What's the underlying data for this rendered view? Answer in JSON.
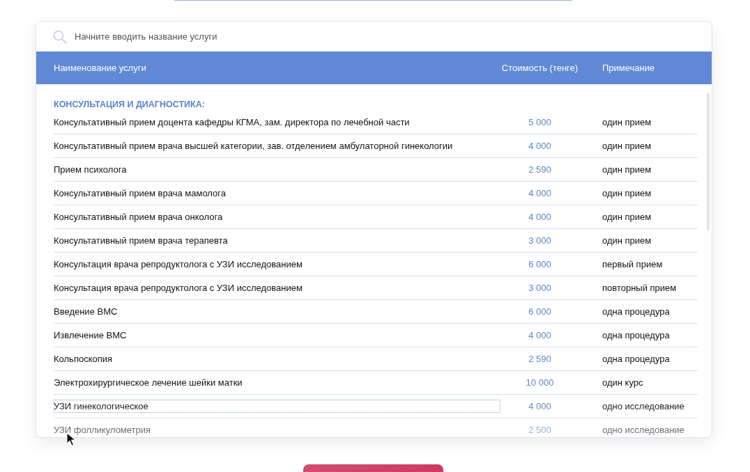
{
  "search": {
    "placeholder": "Начните вводить название услуги"
  },
  "table": {
    "columns": [
      "Наименование услуги",
      "Стоимость (тенге)",
      "Примечание"
    ],
    "category": "КОНСУЛЬТАЦИЯ И ДИАГНОСТИКА:",
    "rows": [
      {
        "name": "Консультативный прием доцента кафедры КГМА, зам. директора по лечебной части",
        "price": "5 000",
        "note": "один прием",
        "focused": false
      },
      {
        "name": "Консультативный прием врача высшей категории, зав. отделением амбулаторной гинекологии",
        "price": "4 000",
        "note": "один прием",
        "focused": false
      },
      {
        "name": "Прием психолога",
        "price": "2 590",
        "note": "один прием",
        "focused": false
      },
      {
        "name": "Консультативный прием врача мамолога",
        "price": "4 000",
        "note": "один прием",
        "focused": false
      },
      {
        "name": "Консультативный прием врача онколога",
        "price": "4 000",
        "note": "один прием",
        "focused": false
      },
      {
        "name": "Консультативный прием врача терапевта",
        "price": "3 000",
        "note": "один прием",
        "focused": false
      },
      {
        "name": "Консультация врача репродуктолога с УЗИ исследованием",
        "price": "6 000",
        "note": "первый прием",
        "focused": false
      },
      {
        "name": "Консультация врача репродуктолога с УЗИ исследованием",
        "price": "3 000",
        "note": "повторный прием",
        "focused": false
      },
      {
        "name": "Введение ВМС",
        "price": "6 000",
        "note": "одна процедура",
        "focused": false
      },
      {
        "name": "Извлечение ВМС",
        "price": "4 000",
        "note": "одна процедура",
        "focused": false
      },
      {
        "name": "Кольпоскопия",
        "price": "2 590",
        "note": "одна процедура",
        "focused": false
      },
      {
        "name": "Электрохирургическое лечение шейки матки",
        "price": "10 000",
        "note": "один курс",
        "focused": false
      },
      {
        "name": "УЗИ гинекологическое",
        "price": "4 000",
        "note": "одно исследование",
        "focused": true
      },
      {
        "name": "УЗИ фолликулометрия",
        "price": "2 500",
        "note": "одно исследование",
        "focused": false
      }
    ]
  }
}
